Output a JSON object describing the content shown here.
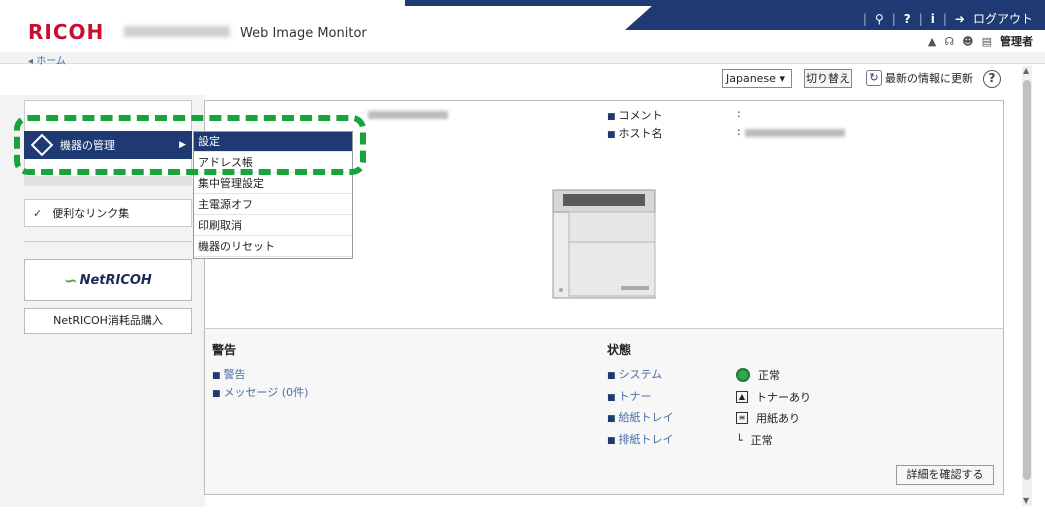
{
  "header": {
    "brand": "RICOH",
    "app_title": "Web Image Monitor",
    "logout_label": "ログアウト",
    "admin_label": "管理者"
  },
  "breadcrumb": {
    "home": "ホーム"
  },
  "controls": {
    "language": "Japanese",
    "switch_label": "切り替え",
    "refresh_label": "最新の情報に更新",
    "help_symbol": "?"
  },
  "sidebar": {
    "menu_main": "機器の管理",
    "useful_links": "便利なリンク集",
    "netricoh_logo": "NetRICOH",
    "netricoh_button": "NetRICOH消耗品購入"
  },
  "submenu": {
    "items": [
      "設定",
      "アドレス帳",
      "集中管理設定",
      "主電源オフ",
      "印刷取消",
      "機器のリセット"
    ]
  },
  "device_info": {
    "comment_label": "コメント",
    "host_label": "ホスト名",
    "colon": ":"
  },
  "alerts": {
    "title": "警告",
    "items": [
      "警告",
      "メッセージ (0件)"
    ]
  },
  "status": {
    "title": "状態",
    "rows": [
      {
        "label": "システム",
        "value": "正常",
        "icon": "ok-icon"
      },
      {
        "label": "トナー",
        "value": "トナーあり",
        "icon": "toner-icon"
      },
      {
        "label": "給紙トレイ",
        "value": "用紙あり",
        "icon": "paper-icon"
      },
      {
        "label": "排紙トレイ",
        "value": "正常",
        "icon": "output-tray-icon"
      }
    ]
  },
  "detail_button": "詳細を確認する",
  "colors": {
    "accent": "#1f3a73",
    "brand": "#c8102e",
    "highlight": "#18a33b"
  }
}
